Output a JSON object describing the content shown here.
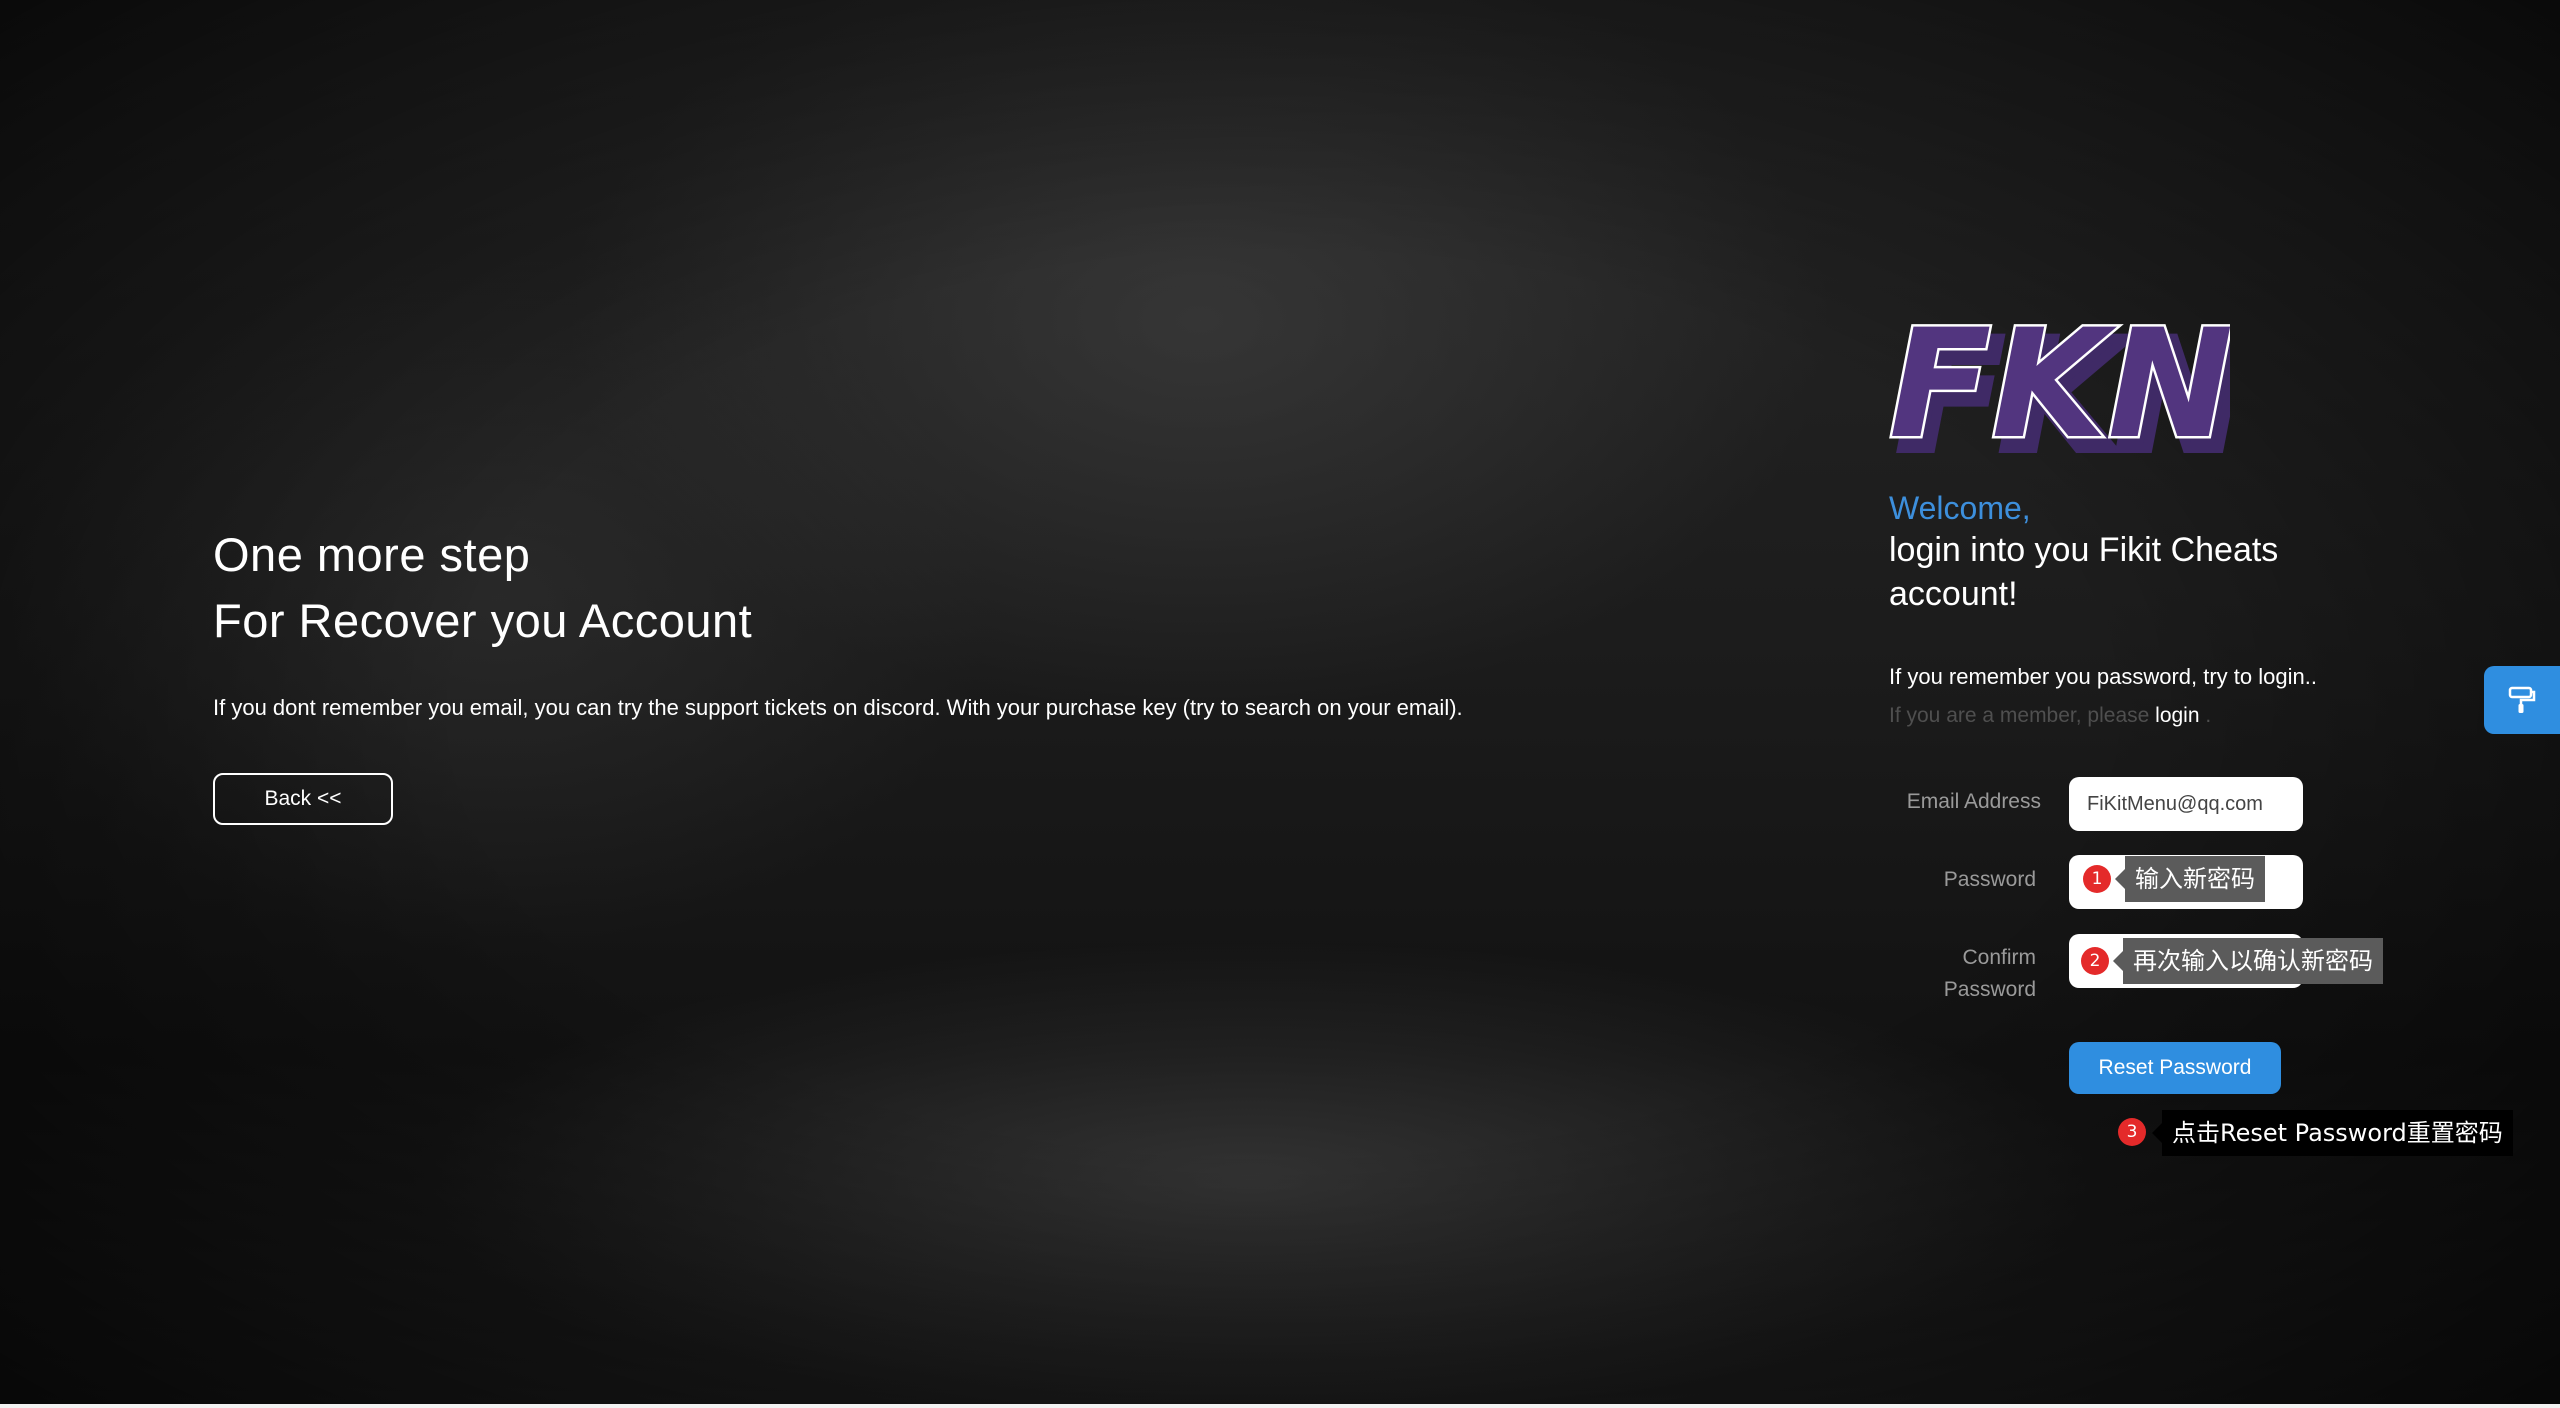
{
  "left_panel": {
    "title_line1": "One more step",
    "title_line2": "For Recover you Account",
    "description": "If you dont remember you email, you can try the support tickets on discord. With your purchase key (try to search on your email).",
    "back_label": "Back <<"
  },
  "right_panel": {
    "logo_text": "FKN",
    "welcome": "Welcome,",
    "heading": "login into you Fikit Cheats account!",
    "remember_text": "If you remember you password, try to login..",
    "member_prefix": "If you are a member, please",
    "login_link": "login",
    "member_suffix": ".",
    "form": {
      "email_label": "Email Address",
      "email_value": "FiKitMenu@qq.com",
      "password_label": "Password",
      "confirm_label_line1": "Confirm",
      "confirm_label_line2": "Password",
      "reset_label": "Reset Password"
    }
  },
  "annotations": [
    {
      "step": "1",
      "text": "输入新密码"
    },
    {
      "step": "2",
      "text": "再次输入以确认新密码"
    },
    {
      "step": "3",
      "text": "点击Reset Password重置密码"
    }
  ],
  "floating_button": {
    "icon": "paint-roller-icon"
  },
  "colors": {
    "accent": "#2f8ee0",
    "welcome": "#3d8fdc",
    "badge": "#e42a2a"
  }
}
